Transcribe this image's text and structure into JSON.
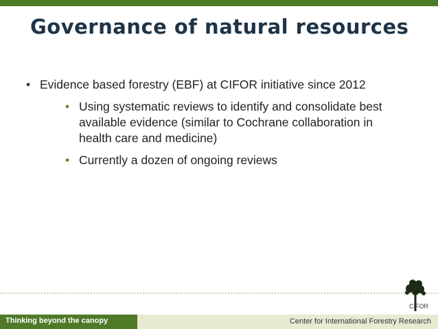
{
  "slide": {
    "title": "Governance of natural resources",
    "bullets": [
      {
        "level": 1,
        "text": "Evidence based forestry (EBF) at CIFOR initiative since 2012"
      },
      {
        "level": 2,
        "text": "Using systematic reviews to identify and consolidate best available evidence (similar to Cochrane collaboration in health care and medicine)"
      },
      {
        "level": 2,
        "text": "Currently a dozen of ongoing reviews"
      }
    ],
    "bullet_marker": "•"
  },
  "footer": {
    "tagline": "Thinking beyond the canopy",
    "organization": "Center for International Forestry Research"
  },
  "logo": {
    "text": "CIFOR",
    "icon": "tree-icon"
  },
  "colors": {
    "brand_green": "#4f7a28",
    "title_navy": "#1e3446",
    "bullet_green": "#5b8a2e",
    "footer_beige": "#e9ead2"
  }
}
